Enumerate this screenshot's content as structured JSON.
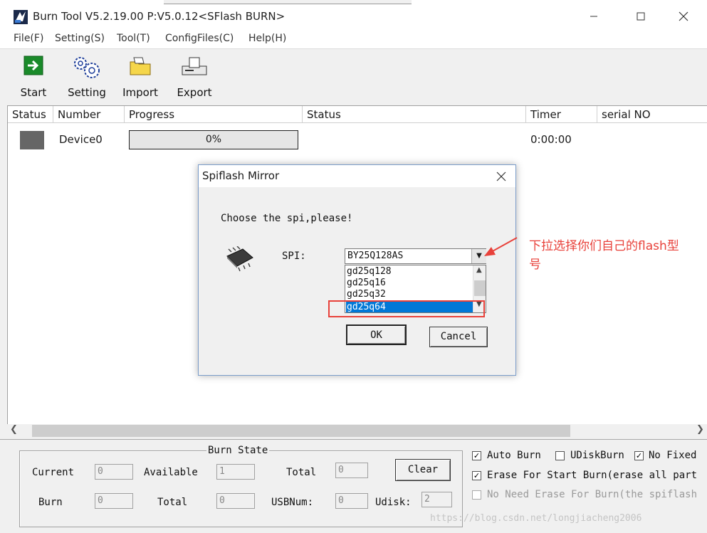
{
  "window": {
    "title": "Burn Tool V5.2.19.00 P:V5.0.12<SFlash BURN>"
  },
  "background_window": {
    "device_label": "Device0",
    "progress": "0%",
    "timer": "0:00:00"
  },
  "menu": [
    "File(F)",
    "Setting(S)",
    "Tool(T)",
    "ConfigFiles(C)",
    "Help(H)"
  ],
  "toolbar": {
    "start": "Start",
    "setting": "Setting",
    "import": "Import",
    "export": "Export"
  },
  "grid": {
    "headers": [
      "Status",
      "Number",
      "Progress",
      "Status",
      "Timer",
      "serial NO"
    ],
    "rows": [
      {
        "status_color": "#666666",
        "number": "Device0",
        "progress": "0%",
        "progress_fraction": 0,
        "status": "",
        "timer": "0:00:00",
        "serial": ""
      }
    ]
  },
  "burn_state": {
    "title": "Burn State",
    "current_label": "Current",
    "current_value": "0",
    "available_label": "Available",
    "available_value": "1",
    "total_label": "Total",
    "total_value": "0",
    "clear_label": "Clear",
    "burn_label": "Burn",
    "burn_value": "0",
    "total2_label": "Total",
    "total2_value": "0",
    "usbnum_label": "USBNum:",
    "usbnum_value": "0",
    "udisk_label": "Udisk:",
    "udisk_value": "2"
  },
  "options": {
    "auto_burn": {
      "label": "Auto Burn",
      "checked": true
    },
    "udisk_burn": {
      "label": "UDiskBurn",
      "checked": false
    },
    "no_fixed": {
      "label": "No Fixed",
      "checked": true
    },
    "erase_start": {
      "label": "Erase For Start Burn(erase all part",
      "checked": true
    },
    "no_need_erase": {
      "label": "No Need Erase For Burn(the spiflash",
      "checked": false,
      "disabled": true
    }
  },
  "dialog": {
    "title": "Spiflash Mirror",
    "prompt": "Choose the spi,please!",
    "spi_label": "SPI:",
    "selected": "BY25Q128AS",
    "options": [
      "gd25q128",
      "gd25q16",
      "gd25q32",
      "gd25q64"
    ],
    "highlighted": "gd25q64",
    "ok_label": "OK",
    "cancel_label": "Cancel"
  },
  "annotation": {
    "text_line1": "下拉选择你们自己的flash型",
    "text_line2": "号",
    "color": "#e8413a"
  },
  "watermark": "https://blog.csdn.net/longjiacheng2006",
  "colors": {
    "selection": "#0078d7",
    "annotation_red": "#e8413a"
  }
}
